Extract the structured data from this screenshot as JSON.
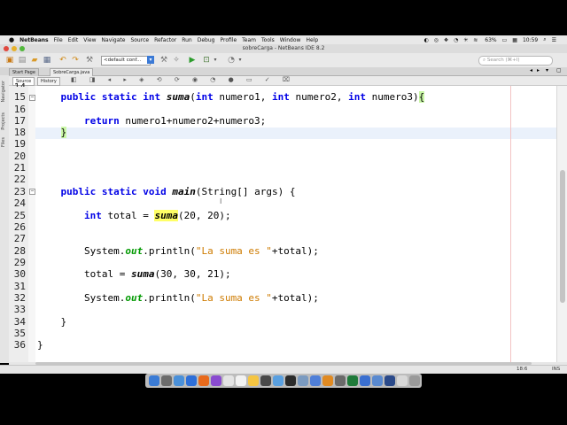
{
  "menubar": {
    "apple": "",
    "app": "NetBeans",
    "items": [
      "File",
      "Edit",
      "View",
      "Navigate",
      "Source",
      "Refactor",
      "Run",
      "Debug",
      "Profile",
      "Team",
      "Tools",
      "Window",
      "Help"
    ],
    "battery": "63%",
    "time": "10:59"
  },
  "window": {
    "title": "sobreCarga - NetBeans IDE 8.2"
  },
  "toolbar": {
    "config_value": "<default conf...",
    "search_placeholder": "Search (⌘+I)"
  },
  "tabs": [
    {
      "label": "Start Page"
    },
    {
      "label": "SobreCarga.java"
    }
  ],
  "side_panels": [
    "Navigator",
    "Projects",
    "Files"
  ],
  "editor_toolbar": {
    "source_label": "Source",
    "history_label": "History"
  },
  "editor": {
    "lines": [
      {
        "num": "14",
        "text": ""
      },
      {
        "num": "15",
        "text": "    public static int suma(int numero1, int numero2, int numero3){"
      },
      {
        "num": "16",
        "text": ""
      },
      {
        "num": "17",
        "text": "        return numero1+numero2+numero3;"
      },
      {
        "num": "18",
        "text": "    }"
      },
      {
        "num": "19",
        "text": ""
      },
      {
        "num": "20",
        "text": ""
      },
      {
        "num": "21",
        "text": ""
      },
      {
        "num": "22",
        "text": ""
      },
      {
        "num": "23",
        "text": "    public static void main(String[] args) {"
      },
      {
        "num": "24",
        "text": ""
      },
      {
        "num": "25",
        "text": "        int total = suma(20, 20);"
      },
      {
        "num": "26",
        "text": ""
      },
      {
        "num": "27",
        "text": ""
      },
      {
        "num": "28",
        "text": "        System.out.println(\"La suma es \"+total);"
      },
      {
        "num": "29",
        "text": ""
      },
      {
        "num": "30",
        "text": "        total = suma(30, 30, 21);"
      },
      {
        "num": "31",
        "text": ""
      },
      {
        "num": "32",
        "text": "        System.out.println(\"La suma es \"+total);"
      },
      {
        "num": "33",
        "text": ""
      },
      {
        "num": "34",
        "text": "    }"
      },
      {
        "num": "35",
        "text": ""
      },
      {
        "num": "36",
        "text": "}"
      }
    ]
  },
  "status": {
    "position": "18:6",
    "mode": "INS"
  },
  "dock": {
    "app_count": 22
  },
  "colors": {
    "keyword": "#0000e6",
    "string": "#ce7b00",
    "field": "#009900",
    "highlight": "#ffff66",
    "current_line": "#eaf1fb"
  }
}
